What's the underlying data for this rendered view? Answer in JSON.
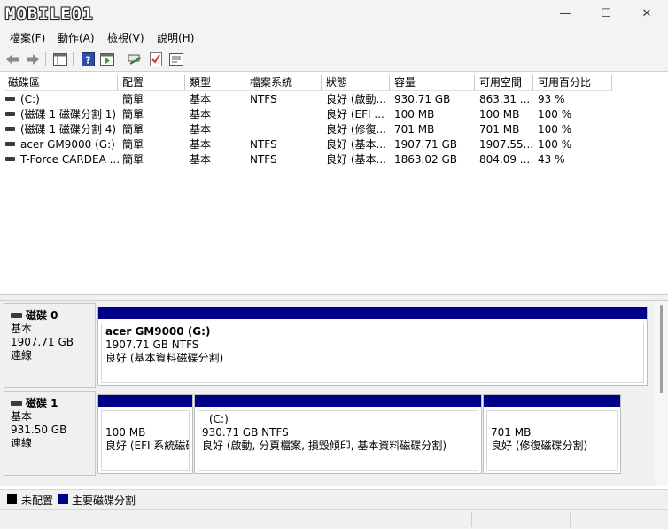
{
  "window": {
    "logo_text": "MOBILE01",
    "controls": {
      "minimize": "—",
      "maximize": "☐",
      "close": "✕"
    }
  },
  "menu": [
    "檔案(F)",
    "動作(A)",
    "檢視(V)",
    "說明(H)"
  ],
  "columns": [
    "磁碟區",
    "配置",
    "類型",
    "檔案系統",
    "狀態",
    "容量",
    "可用空間",
    "可用百分比"
  ],
  "volumes": [
    {
      "name": "(C:)",
      "layout": "簡單",
      "type": "基本",
      "fs": "NTFS",
      "status": "良好 (啟動...",
      "capacity": "930.71 GB",
      "free": "863.31 ...",
      "pct": "93 %"
    },
    {
      "name": "(磁碟 1 磁碟分割 1)",
      "layout": "簡單",
      "type": "基本",
      "fs": "",
      "status": "良好 (EFI ...",
      "capacity": "100 MB",
      "free": "100 MB",
      "pct": "100 %"
    },
    {
      "name": "(磁碟 1 磁碟分割 4)",
      "layout": "簡單",
      "type": "基本",
      "fs": "",
      "status": "良好 (修復...",
      "capacity": "701 MB",
      "free": "701 MB",
      "pct": "100 %"
    },
    {
      "name": "acer GM9000 (G:)",
      "layout": "簡單",
      "type": "基本",
      "fs": "NTFS",
      "status": "良好 (基本...",
      "capacity": "1907.71 GB",
      "free": "1907.55...",
      "pct": "100 %"
    },
    {
      "name": "T-Force CARDEA ...",
      "layout": "簡單",
      "type": "基本",
      "fs": "NTFS",
      "status": "良好 (基本...",
      "capacity": "1863.02 GB",
      "free": "804.09 ...",
      "pct": "43 %"
    }
  ],
  "disks": [
    {
      "label": "磁碟 0",
      "type": "基本",
      "size": "1907.71 GB",
      "state": "連線",
      "partitions": [
        {
          "title": "acer GM9000  (G:)",
          "line1": "1907.71 GB NTFS",
          "line2": "良好 (基本資料磁碟分割)"
        }
      ]
    },
    {
      "label": "磁碟 1",
      "type": "基本",
      "size": "931.50 GB",
      "state": "連線",
      "partitions": [
        {
          "title": "",
          "line1": "100 MB",
          "line2": "良好 (EFI 系統磁碟"
        },
        {
          "title": "(C:)",
          "line1": "930.71 GB NTFS",
          "line2": "良好 (啟動, 分頁檔案, 損毀傾印, 基本資料磁碟分割)"
        },
        {
          "title": "",
          "line1": "701 MB",
          "line2": "良好 (修復磁碟分割)"
        }
      ]
    }
  ],
  "legend": [
    {
      "label": "未配置",
      "color": "#000000"
    },
    {
      "label": "主要磁碟分割",
      "color": "#00008b"
    }
  ]
}
